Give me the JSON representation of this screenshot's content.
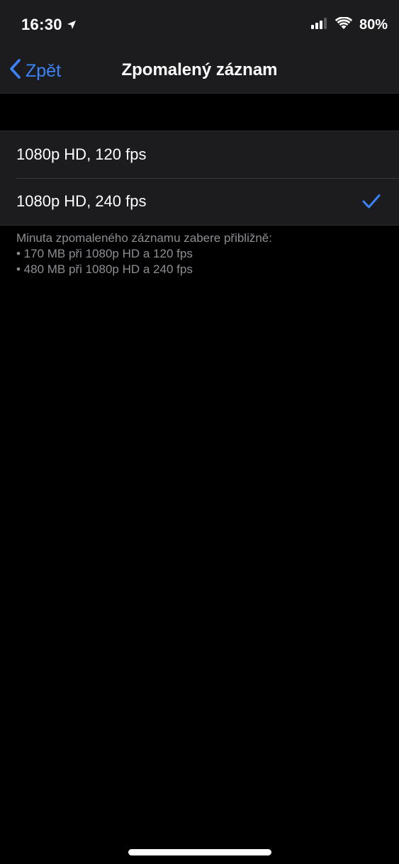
{
  "status_bar": {
    "time": "16:30",
    "battery": "80%",
    "icons": [
      "location-arrow-icon",
      "signal-icon",
      "wifi-icon"
    ]
  },
  "nav": {
    "back_label": "Zpět",
    "title": "Zpomalený záznam"
  },
  "options": [
    {
      "label": "1080p HD, 120 fps",
      "selected": false
    },
    {
      "label": "1080p HD, 240 fps",
      "selected": true
    }
  ],
  "footer": {
    "line1": "Minuta zpomaleného záznamu zabere přibližně:",
    "line2": "• 170 MB při 1080p HD a 120 fps",
    "line3": "• 480 MB při 1080p HD a 240 fps"
  },
  "colors": {
    "accent": "#3b82f6",
    "background": "#000000",
    "cell": "#1c1c1e",
    "secondary_text": "#8e8e93"
  }
}
